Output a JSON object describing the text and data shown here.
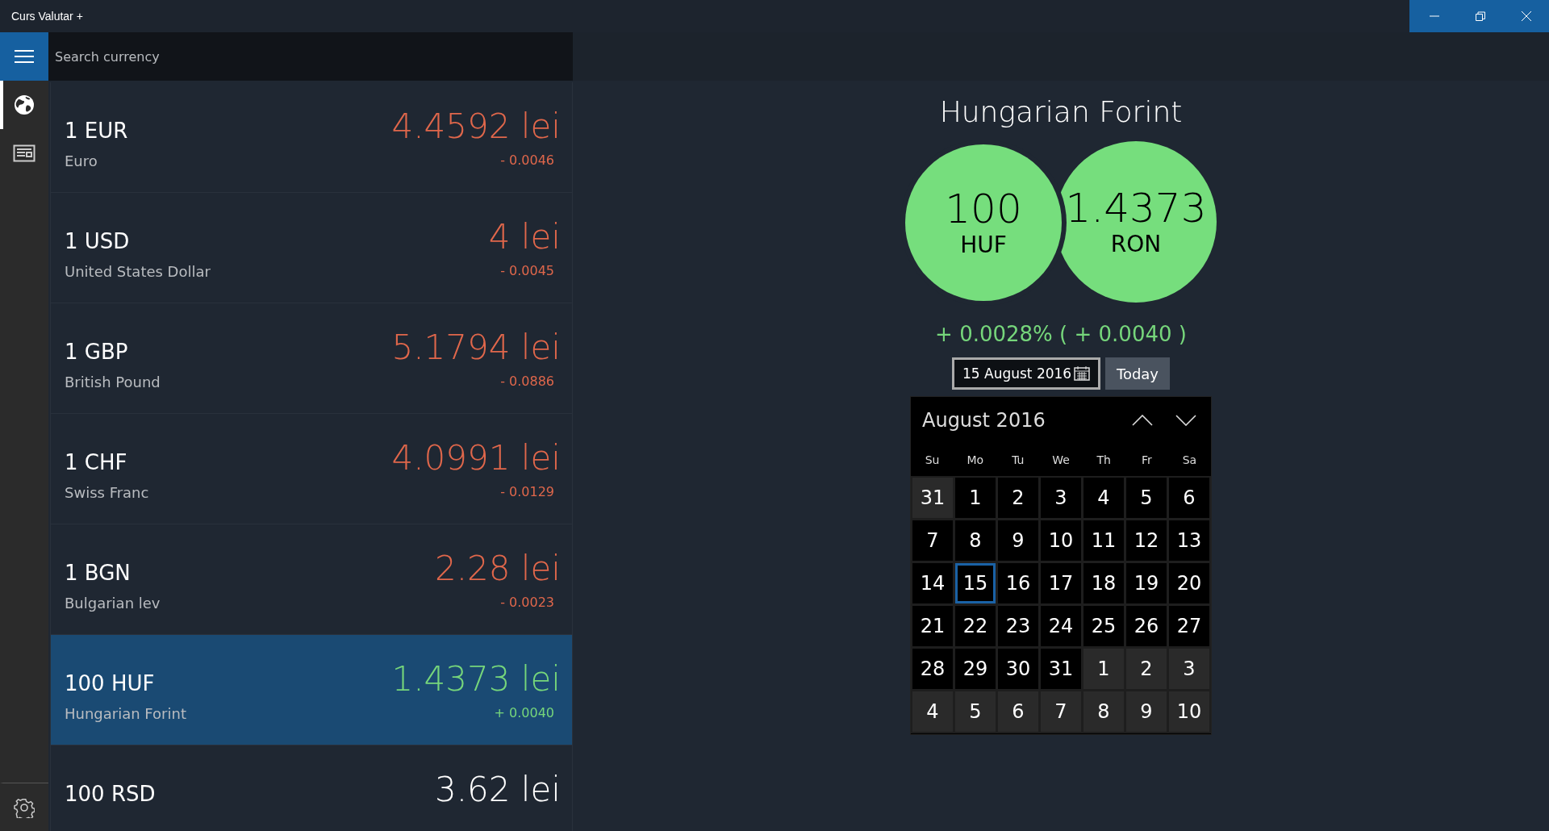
{
  "window": {
    "title": "Curs Valutar +"
  },
  "search": {
    "placeholder": "Search currency"
  },
  "nav": [
    {
      "selected": true
    },
    {
      "selected": false
    }
  ],
  "rates": [
    {
      "amount": "1",
      "code": "EUR",
      "name": "Euro",
      "rate": "4.4592 lei",
      "change": "- 0.0046",
      "color": "#e0674b",
      "selected": false
    },
    {
      "amount": "1",
      "code": "USD",
      "name": "United States Dollar",
      "rate": "4 lei",
      "change": "- 0.0045",
      "color": "#e0674b",
      "selected": false
    },
    {
      "amount": "1",
      "code": "GBP",
      "name": "British Pound",
      "rate": "5.1794 lei",
      "change": "- 0.0886",
      "color": "#e0674b",
      "selected": false
    },
    {
      "amount": "1",
      "code": "CHF",
      "name": "Swiss Franc",
      "rate": "4.0991 lei",
      "change": "- 0.0129",
      "color": "#e0674b",
      "selected": false
    },
    {
      "amount": "1",
      "code": "BGN",
      "name": "Bulgarian lev",
      "rate": "2.28 lei",
      "change": "- 0.0023",
      "color": "#e0674b",
      "selected": false
    },
    {
      "amount": "100",
      "code": "HUF",
      "name": "Hungarian Forint",
      "rate": "1.4373 lei",
      "change": "+ 0.0040",
      "color": "#76d67b",
      "selected": true
    },
    {
      "amount": "100",
      "code": "RSD",
      "rate": "3.62 lei",
      "color": "#ffffff",
      "selected": false
    }
  ],
  "detail": {
    "title": "Hungarian Forint",
    "from": {
      "value": "100",
      "code": "HUF"
    },
    "to": {
      "value": "1.4373",
      "code": "RON"
    },
    "change": "+ 0.0028% ( + 0.0040 )",
    "date": "15 August 2016",
    "today_button": "Today"
  },
  "calendar": {
    "month": "August 2016",
    "weekdays": [
      "Su",
      "Mo",
      "Tu",
      "We",
      "Th",
      "Fr",
      "Sa"
    ],
    "weeks": [
      [
        {
          "day": "31",
          "kind": "adjacent",
          "selected": false
        },
        {
          "day": "1",
          "kind": "current",
          "selected": false
        },
        {
          "day": "2",
          "kind": "current",
          "selected": false
        },
        {
          "day": "3",
          "kind": "current",
          "selected": false
        },
        {
          "day": "4",
          "kind": "current",
          "selected": false
        },
        {
          "day": "5",
          "kind": "current",
          "selected": false
        },
        {
          "day": "6",
          "kind": "current",
          "selected": false
        }
      ],
      [
        {
          "day": "7",
          "kind": "current",
          "selected": false
        },
        {
          "day": "8",
          "kind": "current",
          "selected": false
        },
        {
          "day": "9",
          "kind": "current",
          "selected": false
        },
        {
          "day": "10",
          "kind": "current",
          "selected": false
        },
        {
          "day": "11",
          "kind": "current",
          "selected": false
        },
        {
          "day": "12",
          "kind": "current",
          "selected": false
        },
        {
          "day": "13",
          "kind": "current",
          "selected": false
        }
      ],
      [
        {
          "day": "14",
          "kind": "current",
          "selected": false
        },
        {
          "day": "15",
          "kind": "current",
          "selected": true
        },
        {
          "day": "16",
          "kind": "current",
          "selected": false
        },
        {
          "day": "17",
          "kind": "current",
          "selected": false
        },
        {
          "day": "18",
          "kind": "current",
          "selected": false
        },
        {
          "day": "19",
          "kind": "current",
          "selected": false
        },
        {
          "day": "20",
          "kind": "current",
          "selected": false
        }
      ],
      [
        {
          "day": "21",
          "kind": "current",
          "selected": false
        },
        {
          "day": "22",
          "kind": "current",
          "selected": false
        },
        {
          "day": "23",
          "kind": "current",
          "selected": false
        },
        {
          "day": "24",
          "kind": "current",
          "selected": false
        },
        {
          "day": "25",
          "kind": "current",
          "selected": false
        },
        {
          "day": "26",
          "kind": "current",
          "selected": false
        },
        {
          "day": "27",
          "kind": "current",
          "selected": false
        }
      ],
      [
        {
          "day": "28",
          "kind": "current",
          "selected": false
        },
        {
          "day": "29",
          "kind": "current",
          "selected": false
        },
        {
          "day": "30",
          "kind": "current",
          "selected": false
        },
        {
          "day": "31",
          "kind": "current",
          "selected": false
        },
        {
          "day": "1",
          "kind": "adjacent",
          "selected": false
        },
        {
          "day": "2",
          "kind": "adjacent",
          "selected": false
        },
        {
          "day": "3",
          "kind": "adjacent",
          "selected": false
        }
      ],
      [
        {
          "day": "4",
          "kind": "adjacent",
          "selected": false
        },
        {
          "day": "5",
          "kind": "adjacent",
          "selected": false
        },
        {
          "day": "6",
          "kind": "adjacent",
          "selected": false
        },
        {
          "day": "7",
          "kind": "adjacent",
          "selected": false
        },
        {
          "day": "8",
          "kind": "adjacent",
          "selected": false
        },
        {
          "day": "9",
          "kind": "adjacent",
          "selected": false
        },
        {
          "day": "10",
          "kind": "adjacent",
          "selected": false
        }
      ]
    ]
  }
}
